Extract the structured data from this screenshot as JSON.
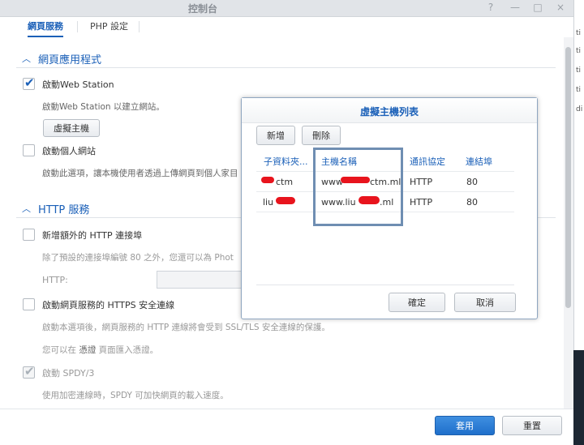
{
  "window": {
    "title": "控制台",
    "controls": [
      "?",
      "—",
      "□",
      "×"
    ]
  },
  "tabs": [
    {
      "label": "網頁服務",
      "active": true
    },
    {
      "label": "PHP 設定",
      "active": false
    }
  ],
  "web_apps": {
    "section_title": "網頁應用程式",
    "web_station_label": "啟動Web Station",
    "web_station_checked": true,
    "web_station_desc": "啟動Web Station 以建立網站。",
    "virtual_host_button": "虛擬主機",
    "personal_site_label": "啟動個人網站",
    "personal_site_checked": false,
    "personal_site_desc": "啟動此選項，讓本機使用者透過上傳網頁到個人家目"
  },
  "http": {
    "section_title": "HTTP 服務",
    "extra_port_label": "新增額外的 HTTP 連接埠",
    "extra_port_checked": false,
    "extra_port_desc": "除了預設的連接埠編號 80 之外，您還可以為 Phot",
    "http_field_label": "HTTP:",
    "https_label": "啟動網頁服務的 HTTPS 安全連線",
    "https_checked": false,
    "https_desc": "啟動本選項後，網頁服務的 HTTP 連線將會受到 SSL/TLS 安全連線的保護。",
    "cert_desc_prefix": "您可以在 ",
    "cert_desc_link": "憑證",
    "cert_desc_suffix": " 頁面匯入憑證。",
    "spdy_label": "啟動 SPDY/3",
    "spdy_checked": true,
    "spdy_desc": "使用加密連線時，SPDY 可加快網頁的載入速度。"
  },
  "footer": {
    "apply_label": "套用",
    "reset_label": "重置"
  },
  "dialog": {
    "title": "虛擬主機列表",
    "add_label": "新增",
    "delete_label": "刪除",
    "columns": [
      "子資料夾...",
      "主機名稱",
      "通訊協定",
      "連結埠"
    ],
    "rows": [
      {
        "subfolder": "ctm",
        "hostname_prefix": "www",
        "hostname_suffix": "ctm.ml",
        "protocol": "HTTP",
        "port": "80"
      },
      {
        "subfolder": "liu",
        "hostname_prefix": "www.liu",
        "hostname_suffix": ".ml",
        "protocol": "HTTP",
        "port": "80"
      }
    ],
    "ok_label": "確定",
    "cancel_label": "取消"
  },
  "side_strip": [
    "ti",
    "ti",
    "ti",
    "ti",
    "di"
  ],
  "colors": {
    "accent": "#1b60b8",
    "redaction": "#e8141d",
    "highlight_box": "#6f8eb2"
  }
}
